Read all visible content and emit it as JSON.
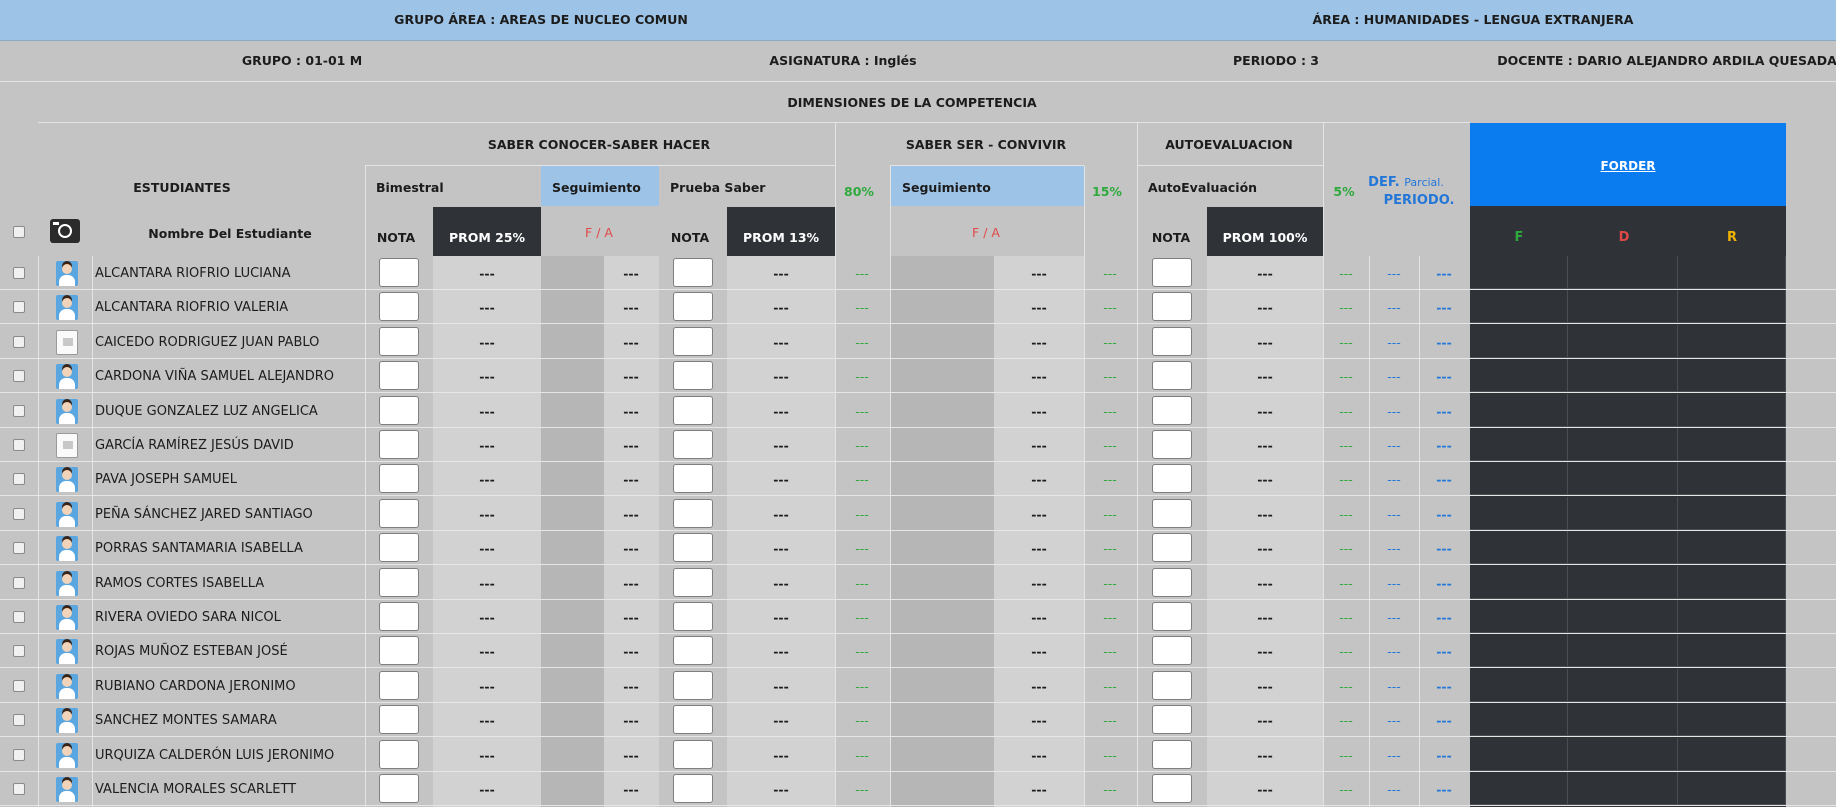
{
  "header": {
    "grupo_area": "GRUPO ÁREA : AREAS DE NUCLEO COMUN",
    "area": "ÁREA : HUMANIDADES - LENGUA EXTRANJERA",
    "grupo": "GRUPO : 01-01 M",
    "asignatura": "ASIGNATURA : Inglés",
    "periodo": "PERIODO : 3",
    "docente": "DOCENTE : DARIO ALEJANDRO ARDILA QUESADA",
    "dimensiones": "DIMENSIONES DE LA COMPETENCIA"
  },
  "columns": {
    "estudiantes": "ESTUDIANTES",
    "nombre": "Nombre Del Estudiante",
    "saber_conocer": "SABER CONOCER-SABER HACER",
    "bimestral": "Bimestral",
    "seguimiento": "Seguimiento",
    "prueba_saber": "Prueba Saber",
    "pct_80": "80%",
    "saber_ser": "SABER SER - CONVIVIR",
    "seguimiento2": "Seguimiento",
    "pct_15": "15%",
    "autoevaluacion_group": "AUTOEVALUACION",
    "autoevaluacion": "AutoEvaluación",
    "pct_5": "5%",
    "def": "DEF.",
    "parcial": "Parcial.",
    "periodo": "PERIODO.",
    "nota1": "NOTA",
    "prom25": "PROM 25%",
    "fa1": "F / A",
    "nota2": "NOTA",
    "prom13": "PROM 13%",
    "fa2": "F / A",
    "nota3": "NOTA",
    "prom100": "PROM 100%",
    "forder": "FORDER",
    "f": "F",
    "d": "D",
    "r": "R"
  },
  "placeholder": "---",
  "students": [
    {
      "name": "ALCANTARA RIOFRIO LUCIANA",
      "photo": "girl"
    },
    {
      "name": "ALCANTARA RIOFRIO VALERIA",
      "photo": "girl"
    },
    {
      "name": "CAICEDO RODRIGUEZ JUAN PABLO",
      "photo": "none"
    },
    {
      "name": "CARDONA VIÑA SAMUEL ALEJANDRO",
      "photo": "boy"
    },
    {
      "name": "DUQUE GONZALEZ LUZ ANGELICA",
      "photo": "girl"
    },
    {
      "name": "GARCÍA RAMÍREZ JESÚS DAVID",
      "photo": "none"
    },
    {
      "name": "PAVA JOSEPH SAMUEL",
      "photo": "boy"
    },
    {
      "name": "PEÑA SÁNCHEZ JARED SANTIAGO",
      "photo": "boy"
    },
    {
      "name": "PORRAS SANTAMARIA ISABELLA",
      "photo": "girl"
    },
    {
      "name": "RAMOS CORTES ISABELLA",
      "photo": "girl"
    },
    {
      "name": "RIVERA OVIEDO SARA NICOL",
      "photo": "girl"
    },
    {
      "name": "ROJAS MUÑOZ ESTEBAN JOSÉ",
      "photo": "boy"
    },
    {
      "name": "RUBIANO CARDONA JERONIMO",
      "photo": "boy"
    },
    {
      "name": "SANCHEZ MONTES SAMARA",
      "photo": "girl"
    },
    {
      "name": "URQUIZA CALDERÓN LUIS JERONIMO",
      "photo": "boy"
    },
    {
      "name": "VALENCIA MORALES SCARLETT",
      "photo": "girl"
    }
  ],
  "colors": {
    "header_blue": "#9dc3e6",
    "forder_blue": "#0a7cf0",
    "dark": "#2f3237",
    "green": "#2eaa3c",
    "red": "#e04848",
    "yellow": "#f0b400",
    "link_blue": "#2377d8"
  }
}
